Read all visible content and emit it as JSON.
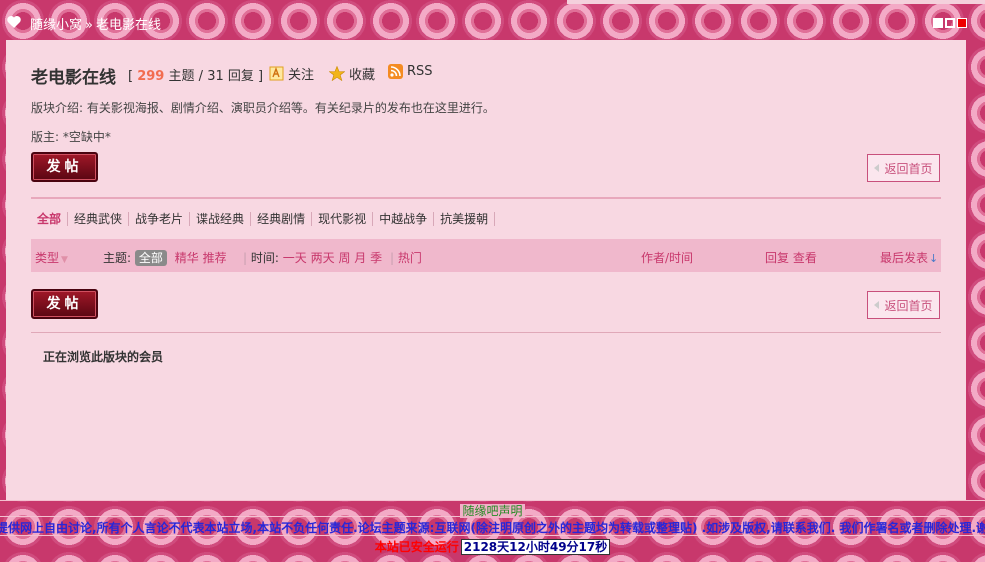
{
  "breadcrumb": {
    "home": "随缘小窝",
    "separator": "»",
    "current": "老电影在线"
  },
  "forum": {
    "title": "老电影在线",
    "stats": {
      "open": "[",
      "threads": "299",
      "threads_label": "主题",
      "divider": "/",
      "replies": "31",
      "replies_label": "回复",
      "close": "]"
    },
    "actions": {
      "follow": "关注",
      "favorite": "收藏",
      "rss": "RSS"
    },
    "description": "版块介绍: 有关影视海报、剧情介绍、演职员介绍等。有关纪录片的发布也在这里进行。",
    "moderators": "版主: *空缺中*"
  },
  "buttons": {
    "post": "发帖",
    "back_home": "返回首页"
  },
  "tabs": [
    {
      "label": "全部",
      "active": true
    },
    {
      "label": "经典武侠"
    },
    {
      "label": "战争老片"
    },
    {
      "label": "谍战经典"
    },
    {
      "label": "经典剧情"
    },
    {
      "label": "现代影视"
    },
    {
      "label": "中越战争"
    },
    {
      "label": "抗美援朝"
    }
  ],
  "filter": {
    "type_label": "类型",
    "topic_label": "主题:",
    "topic_all": "全部",
    "topic_digest": "精华",
    "topic_recommend": "推荐",
    "time_label": "时间:",
    "time_options": [
      "一天",
      "两天",
      "周",
      "月",
      "季"
    ],
    "hot": "热门",
    "author_time": "作者/时间",
    "reply_view": "回复 查看",
    "last_post": "最后发表"
  },
  "browsing": "正在浏览此版块的会员",
  "footer": {
    "heading": "随缘吧声明",
    "declaration": "提供网上自由讨论,所有个人言论不代表本站立场,本站不负任何责任.论坛主题来源:互联网(除注明原创之外的主题均为转载或整理贴) .如涉及版权,请联系我们. 我们作署名或者删除处理.谢",
    "running_label": "本站已安全运行",
    "running_time": "2128天12小时49分17秒"
  },
  "colors": {
    "accent": "#c8386c",
    "panel": "#f8d8e2",
    "filter_bar": "#f0b8cc",
    "threads_number": "#f26c4f",
    "footer_text": "#2727d8",
    "running_label": "#ff0000"
  }
}
